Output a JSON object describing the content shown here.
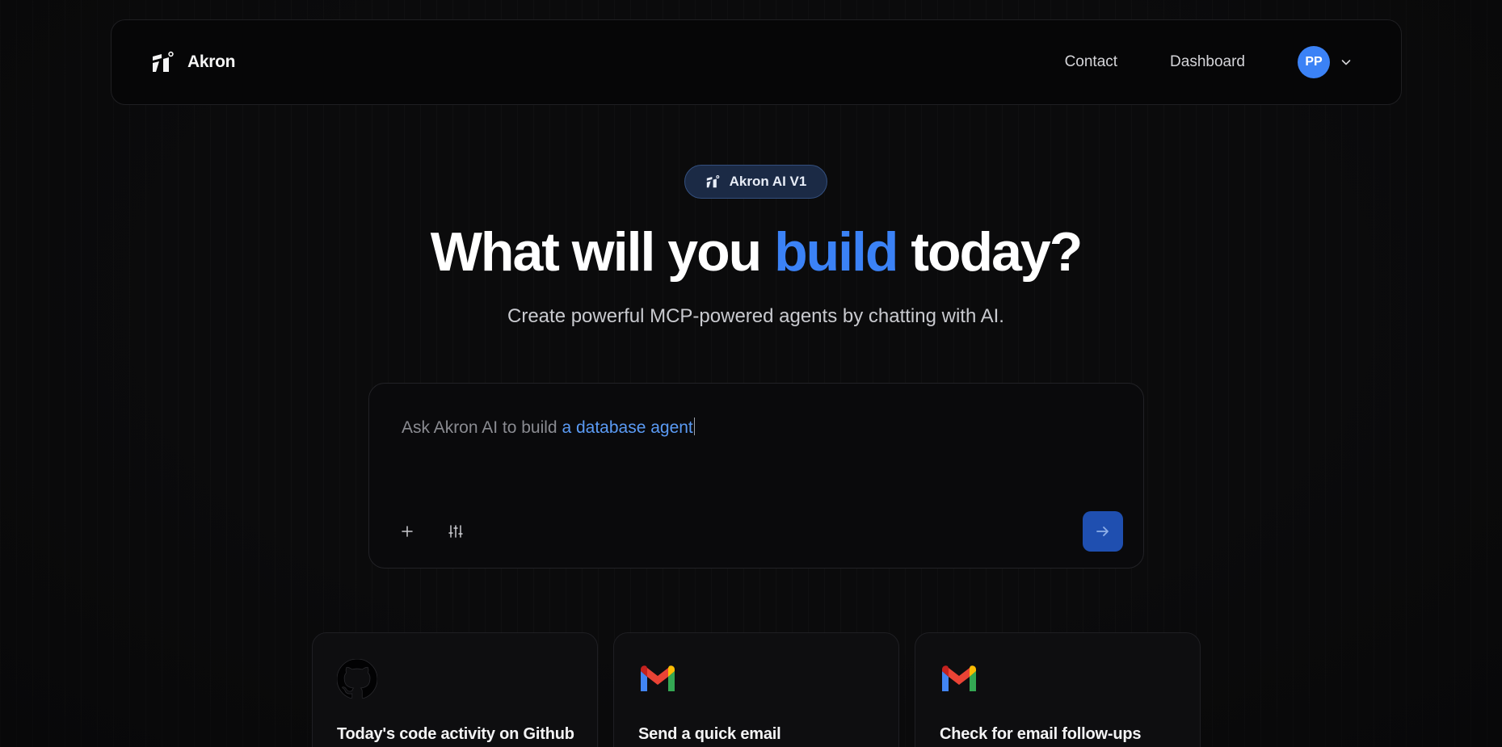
{
  "header": {
    "brand_name": "Akron",
    "nav": [
      {
        "label": "Contact"
      },
      {
        "label": "Dashboard"
      }
    ],
    "avatar_initials": "PP"
  },
  "badge": {
    "label": "Akron AI V1"
  },
  "hero": {
    "title_before": "What will you ",
    "title_accent": "build",
    "title_after": " today?",
    "subtitle": "Create powerful MCP-powered agents by chatting with AI."
  },
  "prompt": {
    "placeholder_prefix": "Ask Akron AI to build ",
    "typed_text": "a database agent"
  },
  "cards": [
    {
      "title": "Today's code activity on Github",
      "icon": "github-icon"
    },
    {
      "title": "Send a quick email",
      "icon": "gmail-icon"
    },
    {
      "title": "Check for email follow-ups",
      "icon": "gmail-icon"
    }
  ],
  "colors": {
    "accent": "#3b82f6",
    "background": "#0b0b0c",
    "send_button": "#1f4fb0"
  }
}
